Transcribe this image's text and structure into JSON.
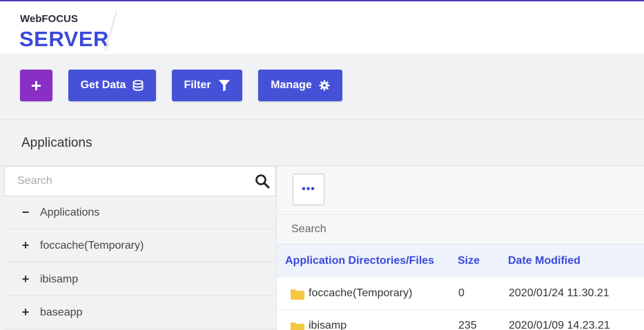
{
  "header": {
    "brand_top": "WebFOCUS",
    "brand_main": "SERVER"
  },
  "toolbar": {
    "add_label": "+",
    "get_data_label": "Get Data",
    "filter_label": "Filter",
    "manage_label": "Manage"
  },
  "section": {
    "title": "Applications"
  },
  "left": {
    "search_placeholder": "Search",
    "tree": [
      {
        "sign": "−",
        "label": "Applications"
      },
      {
        "sign": "+",
        "label": "foccache(Temporary)"
      },
      {
        "sign": "+",
        "label": "ibisamp"
      },
      {
        "sign": "+",
        "label": "baseapp"
      }
    ]
  },
  "right": {
    "more_label": "•••",
    "search_placeholder": "Search",
    "columns": [
      "Application Directories/Files",
      "Size",
      "Date Modified"
    ],
    "rows": [
      {
        "name": "foccache(Temporary)",
        "size": "0",
        "date": "2020/01/24 11.30.21"
      },
      {
        "name": "ibisamp",
        "size": "235",
        "date": "2020/01/09 14.23.21"
      }
    ]
  },
  "colors": {
    "accent": "#3b49d8",
    "button": "#4552d8",
    "add_button": "#8a2fc4",
    "folder": "#f5c842"
  }
}
